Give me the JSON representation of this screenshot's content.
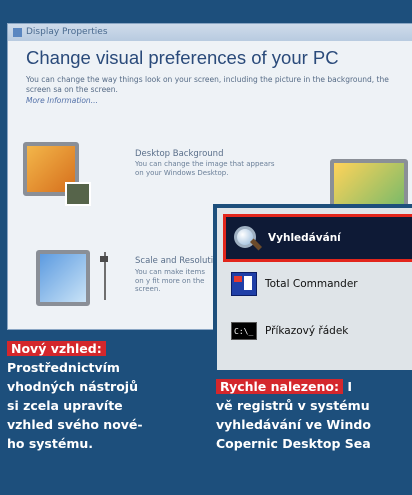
{
  "window": {
    "title": "Display Properties",
    "heading": "Change visual preferences of your PC",
    "description": "You can change the way things look on your screen, including the picture in the background, the screen sa on the screen.",
    "more_link": "More Information...",
    "sections": [
      {
        "title": "Desktop Background",
        "desc": "You can change the image that appears on your Windows Desktop."
      },
      {
        "title": "Scale and Resolutio",
        "desc": "You can make items on y fit more on the screen."
      }
    ]
  },
  "menu": {
    "items": [
      {
        "label": "Vyhledávání",
        "icon": "search-icon"
      },
      {
        "label": "Total Commander",
        "icon": "total-commander-icon"
      },
      {
        "label": "Příkazový řádek",
        "icon": "command-prompt-icon"
      }
    ],
    "cmd_icon_text": "C:\\_"
  },
  "caption_left": {
    "tag": "Nový vzhled:",
    "lines": [
      "Prostřednictvím",
      "vhodných nástrojů",
      "si zcela upravíte",
      "vzhled svého nové-",
      "ho systému."
    ]
  },
  "caption_right": {
    "tag": "Rychle nalezeno:",
    "tail": "I",
    "lines": [
      "vě registrů v systému",
      "vyhledávání ve Windo",
      "Copernic Desktop Sea"
    ]
  },
  "colors": {
    "background": "#1d4f7c",
    "accent": "#d4272c",
    "highlight_border": "#e2261c"
  }
}
